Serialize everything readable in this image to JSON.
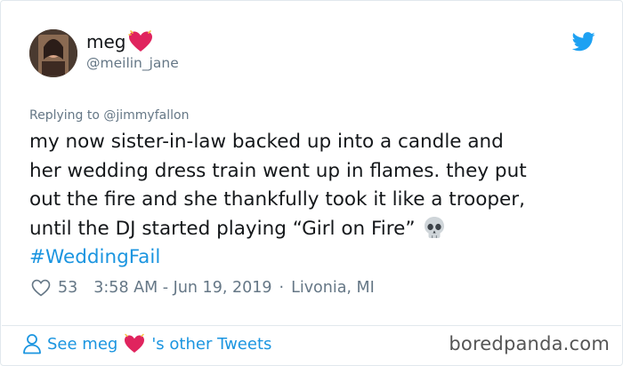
{
  "author": {
    "display_name": "meg",
    "handle": "@meilin_jane"
  },
  "replying_to": "Replying to @jimmyfallon",
  "tweet": {
    "line1": "my now sister-in-law backed up into a candle and",
    "line2": "her wedding dress train went up in flames. they put",
    "line3": "out the fire and she thankfully took it like a trooper,",
    "line4": "until the DJ started playing “Girl on Fire”",
    "hashtag": "#WeddingFail"
  },
  "meta": {
    "likes": "53",
    "timestamp": "3:58 AM - Jun 19, 2019",
    "separator": "·",
    "location": "Livonia, MI"
  },
  "footer": {
    "see_prefix": "See meg",
    "see_suffix": "'s other Tweets",
    "watermark": "boredpanda.com"
  },
  "colors": {
    "link_blue": "#1b95e0",
    "heart_red": "#e0245e",
    "secondary_gray": "#657786"
  },
  "icons": {
    "twitter": "twitter-bird-icon",
    "heart_badge": "sparkling-heart-icon",
    "skull": "skull-icon",
    "like": "heart-outline-icon",
    "person": "person-icon"
  }
}
